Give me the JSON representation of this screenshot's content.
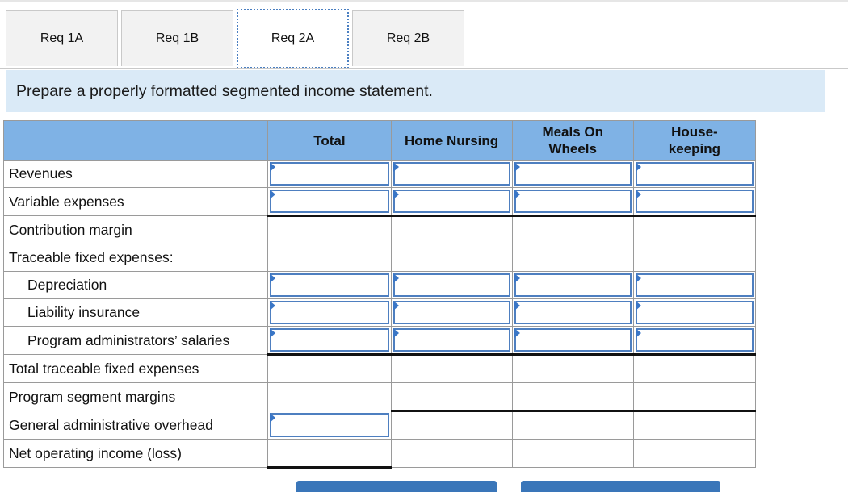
{
  "tabs": [
    {
      "label": "Req 1A"
    },
    {
      "label": "Req 1B"
    },
    {
      "label": "Req 2A",
      "active": true
    },
    {
      "label": "Req 2B"
    }
  ],
  "instruction": "Prepare a properly formatted segmented income statement.",
  "table": {
    "columns": [
      "Total",
      "Home Nursing",
      "Meals On Wheels",
      "House-keeping"
    ],
    "rows": [
      {
        "label": "Revenues"
      },
      {
        "label": "Variable expenses"
      },
      {
        "label": "Contribution margin"
      },
      {
        "label": "Traceable fixed expenses:"
      },
      {
        "label": "Depreciation"
      },
      {
        "label": "Liability insurance"
      },
      {
        "label": "Program administrators’ salaries"
      },
      {
        "label": "Total traceable fixed expenses"
      },
      {
        "label": "Program segment margins"
      },
      {
        "label": "General administrative overhead"
      },
      {
        "label": "Net operating income (loss)"
      }
    ]
  },
  "buttons": {
    "prev_label": "",
    "next_label": ""
  },
  "colors": {
    "header_bg": "#7fb2e5",
    "instruction_bg": "#daeaf7",
    "input_border": "#4e7fc0",
    "button_bg": "#3a76b9"
  }
}
